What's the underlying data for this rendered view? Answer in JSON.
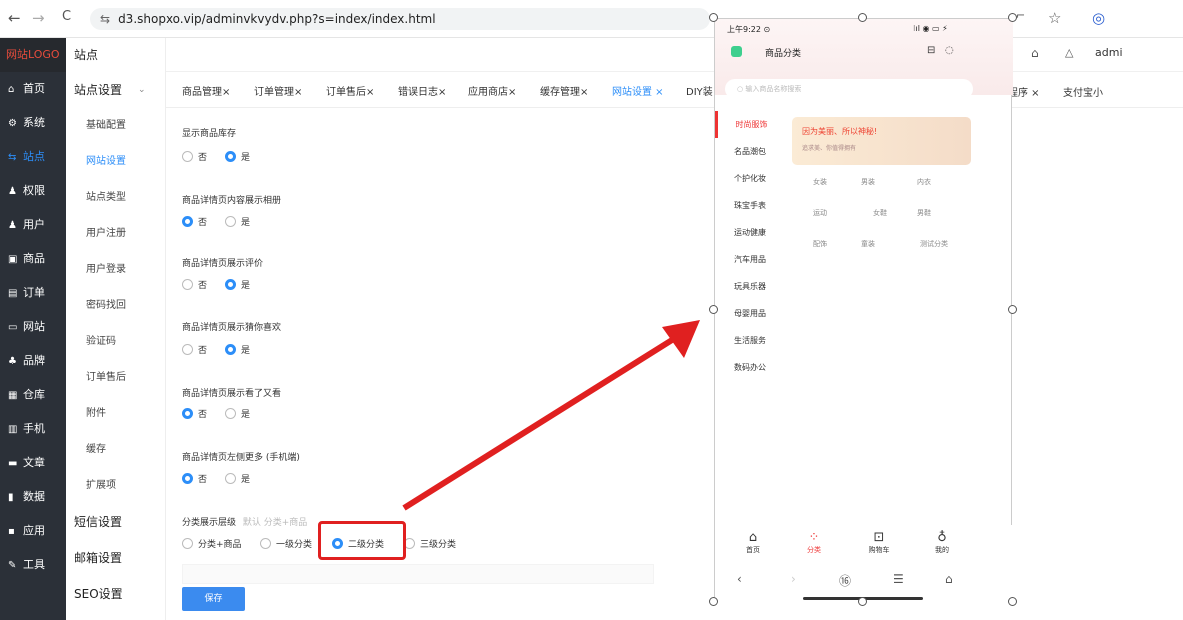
{
  "browser": {
    "back": "←",
    "forward": "→",
    "reload": "C",
    "url": "d3.shopxo.vip/adminvkvydv.php?s=index/index.html",
    "tune": "⇆"
  },
  "topright": {
    "key_icon": "⌐",
    "star": "☆",
    "profile": "◎",
    "home": "⌂",
    "bell": "△",
    "user": "admi"
  },
  "sidebar": {
    "logo": "网站LOGO",
    "items": [
      {
        "label": "首页",
        "icon": "⌂"
      },
      {
        "label": "系统",
        "icon": "⚙"
      },
      {
        "label": "站点",
        "icon": "⇆"
      },
      {
        "label": "权限",
        "icon": "♟"
      },
      {
        "label": "用户",
        "icon": "♟"
      },
      {
        "label": "商品",
        "icon": "▣"
      },
      {
        "label": "订单",
        "icon": "▤"
      },
      {
        "label": "网站",
        "icon": "▭"
      },
      {
        "label": "品牌",
        "icon": "♣"
      },
      {
        "label": "仓库",
        "icon": "▦"
      },
      {
        "label": "手机",
        "icon": "▥"
      },
      {
        "label": "文章",
        "icon": "▬"
      },
      {
        "label": "数据",
        "icon": "▮"
      },
      {
        "label": "应用",
        "icon": "▪"
      },
      {
        "label": "工具",
        "icon": "✎"
      }
    ]
  },
  "submenu": {
    "title": "站点",
    "group": "站点设置",
    "items": [
      "基础配置",
      "网站设置",
      "站点类型",
      "用户注册",
      "用户登录",
      "密码找回",
      "验证码",
      "订单售后",
      "附件",
      "缓存",
      "扩展项"
    ],
    "sections": [
      "短信设置",
      "邮箱设置",
      "SEO设置"
    ]
  },
  "tabs": [
    "商品管理×",
    "订单管理×",
    "订单售后×",
    "错误日志×",
    "应用商店×",
    "缓存管理×",
    "网站设置 ×",
    "DIY装"
  ],
  "tabs_right": [
    "程序 ×",
    "支付宝小"
  ],
  "form": {
    "fields": [
      {
        "label": "显示商品库存",
        "options": [
          "否",
          "是"
        ],
        "selected": 1
      },
      {
        "label": "商品详情页内容展示相册",
        "options": [
          "否",
          "是"
        ],
        "selected": 0
      },
      {
        "label": "商品详情页展示评价",
        "options": [
          "否",
          "是"
        ],
        "selected": 1
      },
      {
        "label": "商品详情页展示猜你喜欢",
        "options": [
          "否",
          "是"
        ],
        "selected": 1
      },
      {
        "label": "商品详情页展示看了又看",
        "options": [
          "否",
          "是"
        ],
        "selected": 0
      },
      {
        "label": "商品详情页左侧更多 (手机端)",
        "options": [
          "否",
          "是"
        ],
        "selected": 0
      }
    ],
    "level": {
      "label": "分类展示层级",
      "hint": "默认 分类+商品",
      "options": [
        "分类+商品",
        "一级分类",
        "二级分类",
        "三级分类"
      ],
      "selected": 2
    },
    "save": "保存"
  },
  "phone": {
    "time": "上午9:22 ⊙",
    "signal": "⁝ıl ◉ ▭ ⚡",
    "title": "商品分类",
    "search": "输入商品名称搜索",
    "categories": [
      "时尚服饰",
      "名品潮包",
      "个护化妆",
      "珠宝手表",
      "运动健康",
      "汽车用品",
      "玩具乐器",
      "母婴用品",
      "生活服务",
      "数码办公"
    ],
    "banner": {
      "title": "因为美丽、所以神秘!",
      "sub": "追求美、你值得拥有"
    },
    "grid": [
      "女装",
      "男装",
      "内衣",
      "运动",
      "女鞋",
      "男鞋",
      "配饰",
      "童装",
      "测试分类"
    ],
    "nav": [
      {
        "label": "首页",
        "icon": "⌂"
      },
      {
        "label": "分类",
        "icon": "⁘"
      },
      {
        "label": "购物车",
        "icon": "⊡"
      },
      {
        "label": "我的",
        "icon": "♁"
      }
    ],
    "sysnav": [
      "‹",
      "›",
      "⑯",
      "☰",
      "⌂"
    ]
  },
  "colors": {
    "accent": "#2c8ef8",
    "red": "#e02020"
  }
}
